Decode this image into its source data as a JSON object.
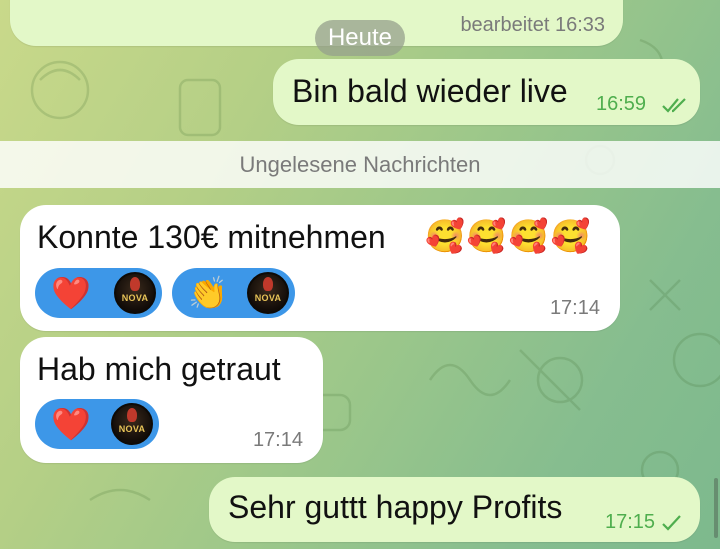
{
  "chat": {
    "prev_message_edited": "bearbeitet 16:33",
    "date_pill": "Heute",
    "unread_banner": "Ungelesene Nachrichten"
  },
  "messages": [
    {
      "text": "Bin bald wieder live",
      "time": "16:59",
      "direction": "outgoing",
      "status": "read-double-check"
    },
    {
      "text": "Konnte 130€ mitnehmen",
      "emojis": "🥰🥰🥰🥰",
      "time": "17:14",
      "direction": "incoming",
      "reactions": [
        {
          "emoji": "❤️",
          "avatar_label": "NOVA"
        },
        {
          "emoji": "👏",
          "avatar_label": "NOVA"
        }
      ]
    },
    {
      "text": "Hab mich getraut",
      "time": "17:14",
      "direction": "incoming",
      "reactions": [
        {
          "emoji": "❤️",
          "avatar_label": "NOVA"
        }
      ]
    },
    {
      "text": "Sehr guttt happy Profits",
      "time": "17:15",
      "direction": "outgoing",
      "status": "sent-single-check"
    }
  ],
  "colors": {
    "incoming_bubble": "#ffffff",
    "outgoing_bubble": "#e3f8c8",
    "reaction_pill": "#3d97e8",
    "check_green": "#4fae4e"
  },
  "icons": [
    "double-check-icon",
    "single-check-icon",
    "heart-icon",
    "clap-icon",
    "nova-avatar-icon"
  ]
}
